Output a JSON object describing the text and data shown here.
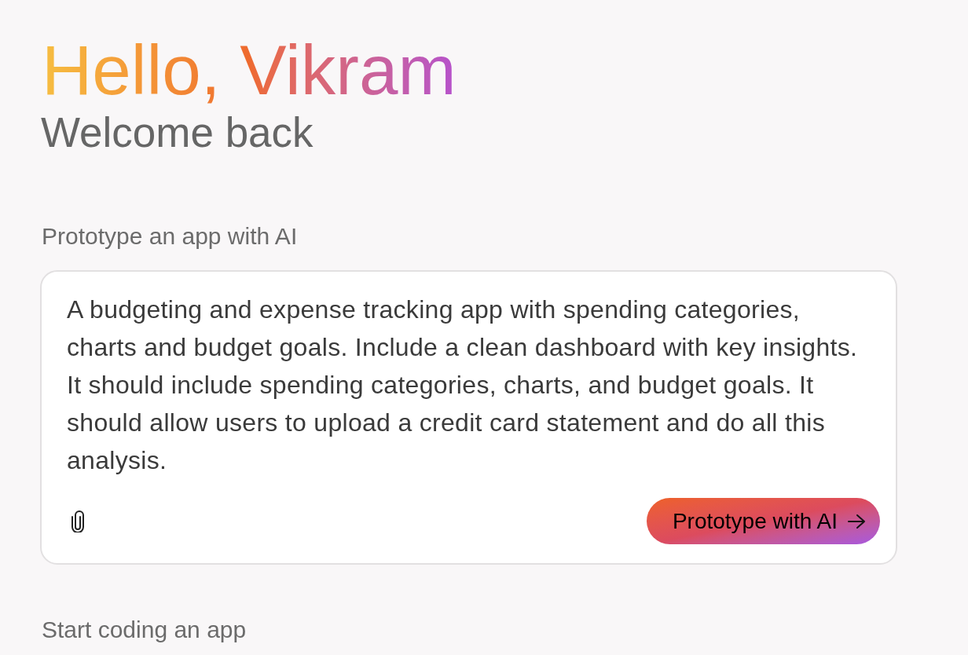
{
  "greeting": {
    "title": "Hello, Vikram",
    "subtitle": "Welcome back"
  },
  "prototype_section": {
    "label": "Prototype an app with AI",
    "prompt": {
      "value": "A budgeting and expense tracking app with spending categories, charts and budget goals. Include a clean dashboard with key insights. It should include spending categories, charts, and budget goals. It should allow users to upload a credit card statement and do all this analysis."
    },
    "submit_button": {
      "label": "Prototype with AI"
    }
  },
  "coding_section": {
    "label": "Start coding an app"
  }
}
